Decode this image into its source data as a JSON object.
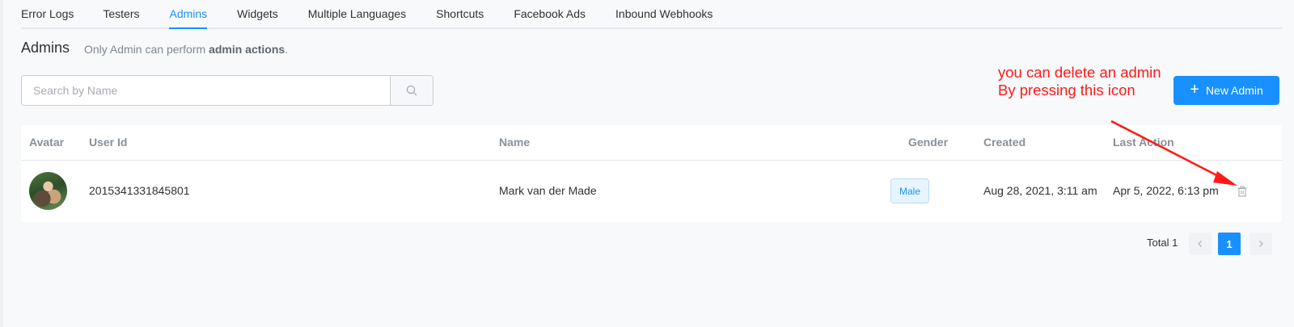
{
  "tabs": [
    {
      "label": "Error Logs",
      "active": false
    },
    {
      "label": "Testers",
      "active": false
    },
    {
      "label": "Admins",
      "active": true
    },
    {
      "label": "Widgets",
      "active": false
    },
    {
      "label": "Multiple Languages",
      "active": false
    },
    {
      "label": "Shortcuts",
      "active": false
    },
    {
      "label": "Facebook Ads",
      "active": false
    },
    {
      "label": "Inbound Webhooks",
      "active": false
    }
  ],
  "header": {
    "title": "Admins",
    "subtitle_prefix": "Only Admin can perform ",
    "subtitle_bold": "admin actions",
    "subtitle_suffix": "."
  },
  "search": {
    "placeholder": "Search by Name",
    "value": "",
    "icon": "search-icon"
  },
  "new_admin_button": {
    "label": "New Admin",
    "icon": "plus-icon"
  },
  "annotation": {
    "line1": "you can delete an admin",
    "line2": "By pressing this icon",
    "color": "#ff1a1a"
  },
  "table": {
    "columns": [
      "Avatar",
      "User Id",
      "Name",
      "Gender",
      "Created",
      "Last Action"
    ],
    "rows": [
      {
        "avatar": "user-avatar-photo",
        "user_id": "2015341331845801",
        "name": "Mark van der Made",
        "gender": "Male",
        "created": "Aug 28, 2021, 3:11 am",
        "last_action": "Apr 5, 2022, 6:13 pm",
        "action_icon": "trash-icon"
      }
    ]
  },
  "pagination": {
    "total_label": "Total 1",
    "current_page": "1",
    "prev_icon": "chevron-left-icon",
    "next_icon": "chevron-right-icon"
  },
  "colors": {
    "accent": "#1890ff",
    "annotation": "#ff1a1a",
    "background": "#f8f9fb"
  }
}
